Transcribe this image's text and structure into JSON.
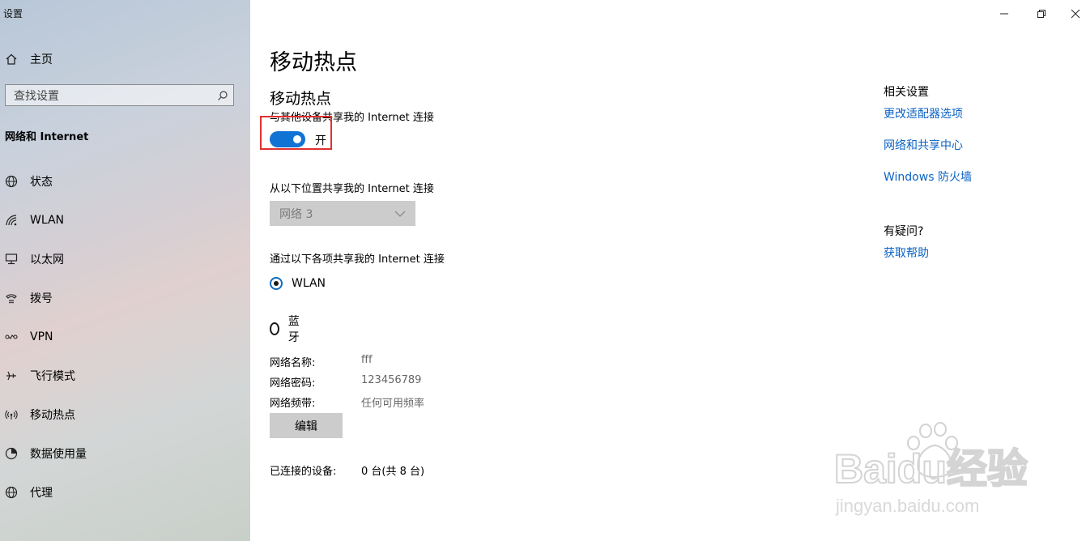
{
  "window": {
    "app_title": "设置"
  },
  "sidebar": {
    "home_label": "主页",
    "search_placeholder": "查找设置",
    "section_title": "网络和 Internet",
    "items": [
      {
        "label": "状态",
        "icon": "status-globe-icon"
      },
      {
        "label": "WLAN",
        "icon": "wifi-icon"
      },
      {
        "label": "以太网",
        "icon": "ethernet-icon"
      },
      {
        "label": "拨号",
        "icon": "dialup-icon"
      },
      {
        "label": "VPN",
        "icon": "vpn-icon"
      },
      {
        "label": "飞行模式",
        "icon": "airplane-icon"
      },
      {
        "label": "移动热点",
        "icon": "hotspot-icon"
      },
      {
        "label": "数据使用量",
        "icon": "data-usage-icon"
      },
      {
        "label": "代理",
        "icon": "proxy-globe-icon"
      }
    ]
  },
  "main": {
    "page_title": "移动热点",
    "section_title": "移动热点",
    "share_desc": "与其他设备共享我的 Internet 连接",
    "toggle_state": "开",
    "share_from_label": "从以下位置共享我的 Internet 连接",
    "share_from_value": "网络 3",
    "share_over_label": "通过以下各项共享我的 Internet 连接",
    "options": [
      {
        "label": "WLAN",
        "selected": true
      },
      {
        "label": "蓝牙",
        "selected": false
      }
    ],
    "name_label": "网络名称:",
    "name_value": "fff",
    "password_label": "网络密码:",
    "password_value": "123456789",
    "band_label": "网络频带:",
    "band_value": "任何可用频率",
    "edit_label": "编辑",
    "connected_label": "已连接的设备:",
    "connected_value": "0 台(共 8 台)"
  },
  "related": {
    "title": "相关设置",
    "links": [
      "更改适配器选项",
      "网络和共享中心",
      "Windows 防火墙"
    ],
    "question_title": "有疑问?",
    "help_link": "获取帮助"
  },
  "watermark": {
    "brand": "Baidu经验",
    "url": "jingyan.baidu.com"
  },
  "colors": {
    "accent": "#1173d4",
    "link": "#0b63c4",
    "highlight_box": "#e0312f"
  }
}
